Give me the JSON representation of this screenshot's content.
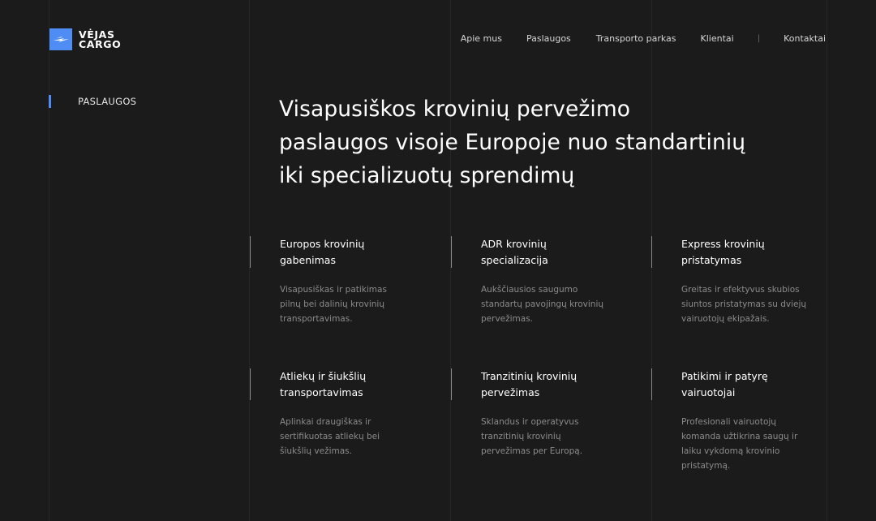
{
  "brand": {
    "line1": "VĖJAS",
    "line2": "CARGO",
    "accent": "#4f8df5",
    "icon": "wind-arrow-icon"
  },
  "nav": {
    "items": [
      "Apie mus",
      "Paslaugos",
      "Transporto parkas",
      "Klientai"
    ],
    "separator": "|",
    "contact": "Kontaktai"
  },
  "section_label": "PASLAUGOS",
  "headline": [
    "Visapusiškos krovinių pervežimo",
    "paslaugos visoje Europoje nuo standartinių",
    "iki specializuotų sprendimų"
  ],
  "services": [
    {
      "title": [
        "Europos krovinių",
        "gabenimas"
      ],
      "desc": [
        "Visapusiškas ir patikimas",
        "pilnų bei dalinių krovinių",
        "transportavimas."
      ]
    },
    {
      "title": [
        "ADR krovinių",
        "specializacija"
      ],
      "desc": [
        "Aukščiausios saugumo",
        "standartų pavojingų krovinių",
        "pervežimas."
      ]
    },
    {
      "title": [
        "Express krovinių",
        "pristatymas"
      ],
      "desc": [
        "Greitas ir efektyvus skubios",
        "siuntos pristatymas su dviejų",
        "vairuotojų ekipažais."
      ]
    },
    {
      "title": [
        "Atliekų ir šiukšlių",
        "transportavimas"
      ],
      "desc": [
        "Aplinkai draugiškas ir",
        "sertifikuotas atliekų bei",
        "šiukšlių vežimas."
      ]
    },
    {
      "title": [
        "Tranzitinių krovinių",
        "pervežimas"
      ],
      "desc": [
        "Sklandus ir operatyvus",
        "tranzitinių krovinių",
        "pervežimas per Europą."
      ]
    },
    {
      "title": [
        "Patikimi ir patyrę",
        "vairuotojai"
      ],
      "desc": [
        "Profesionali vairuotojų",
        "komanda užtikrina saugų ir",
        "laiku vykdomą krovinio",
        "pristatymą."
      ]
    }
  ]
}
